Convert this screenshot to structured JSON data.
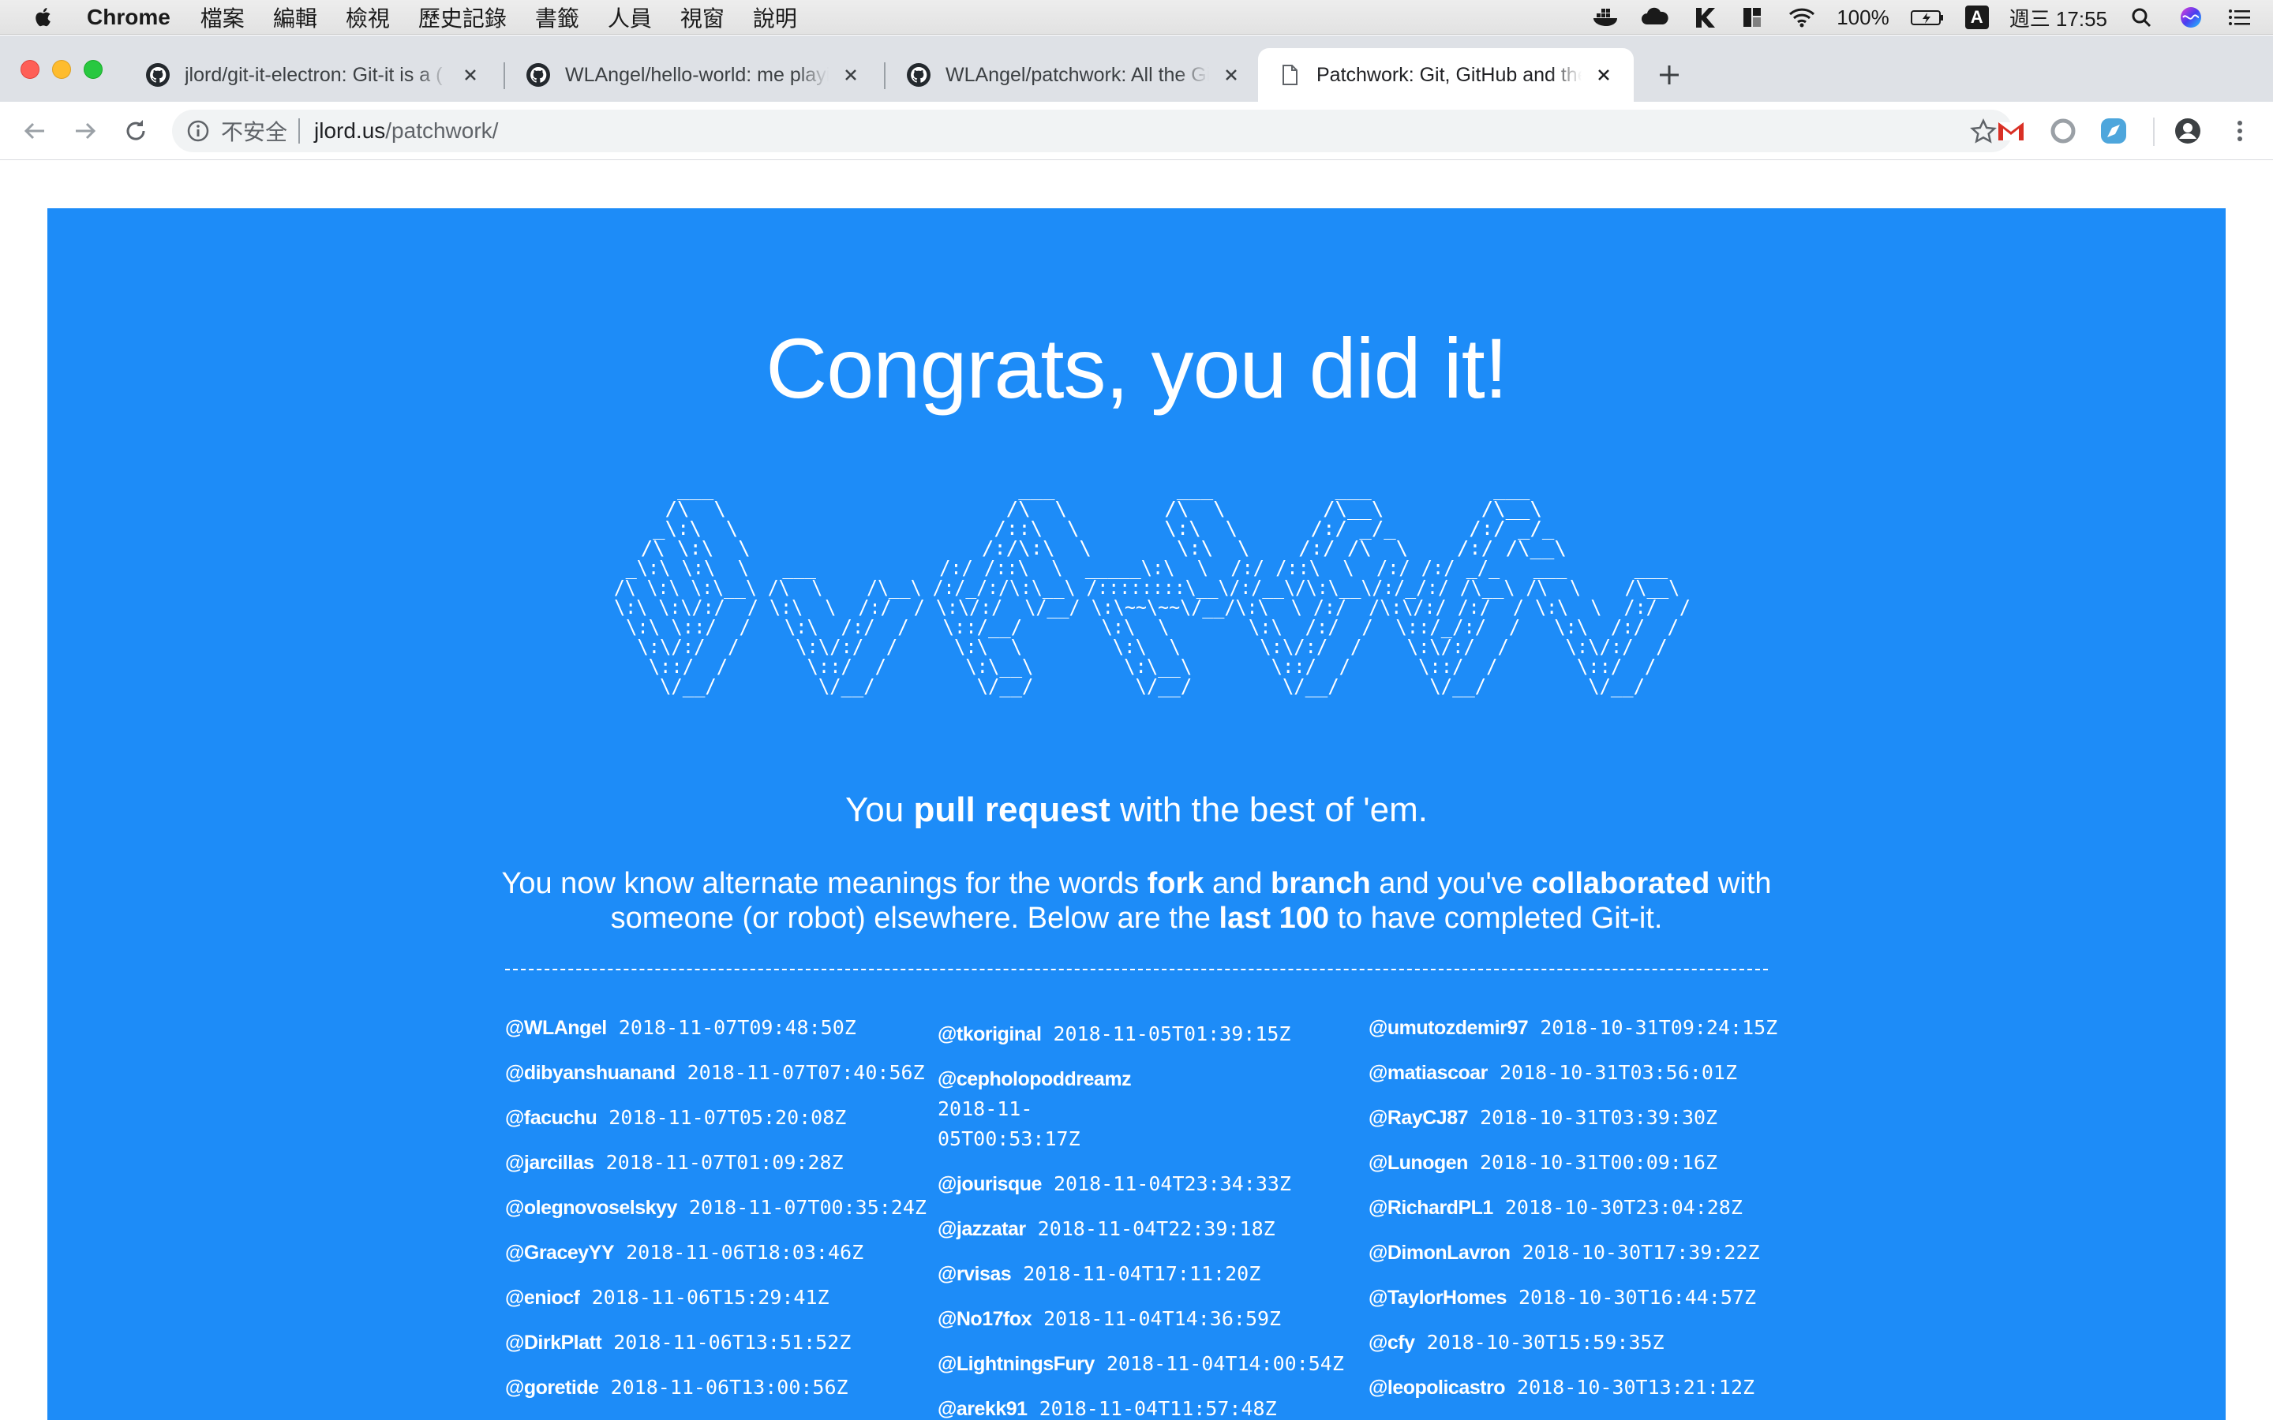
{
  "menubar": {
    "app": "Chrome",
    "items": [
      "檔案",
      "編輯",
      "檢視",
      "歷史記錄",
      "書籤",
      "人員",
      "視窗",
      "說明"
    ],
    "battery": "100%",
    "input_method": "A",
    "clock": "週三 17:55",
    "tray_icons": [
      "docker-icon",
      "cloud-icon",
      "k-icon",
      "grid-icon",
      "wifi-icon",
      "battery-icon",
      "input-icon",
      "search-icon",
      "siri-icon",
      "list-icon"
    ]
  },
  "tabs": [
    {
      "title": "jlord/git-it-electron: Git-it is a (",
      "icon": "github-icon",
      "active": false
    },
    {
      "title": "WLAngel/hello-world: me playin",
      "icon": "github-icon",
      "active": false
    },
    {
      "title": "WLAngel/patchwork: All the Git",
      "icon": "github-icon",
      "active": false
    },
    {
      "title": "Patchwork: Git, GitHub and the",
      "icon": "document-icon",
      "active": true
    }
  ],
  "omnibox": {
    "security": "不安全",
    "host": "jlord.us",
    "path": "/patchwork/"
  },
  "page": {
    "title": "Congrats, you did it!",
    "ascii_art": [
      "       ___                         ___          ___          ___          ___               ",
      "      /\\  \\                       /\\  \\        /\\  \\        /\\__\\        /\\__\\              ",
      "     _\\:\\  \\                     /::\\  \\       \\:\\  \\      /:/ _/_      /:/ _/_             ",
      "    /\\ \\:\\  \\                   /:/\\:\\  \\       \\:\\  \\    /:/ /\\  \\    /:/ /\\__\\            ",
      "   _\\:\\ \\:\\  \\   ___           /:/ /::\\  \\  _____\\:\\  \\  /:/ /::\\  \\  /:/ /:/ _/_   ___      ___    ",
      "  /\\ \\:\\ \\:\\__\\ /\\  \\    /\\__\\ /:/_/:/\\:\\__\\ /::::::::\\__\\/:/__\\/\\:\\__\\/:/_/:/ /\\__\\ /\\  \\    /\\__\\   ",
      "  \\:\\ \\:\\/:/  / \\:\\  \\  /:/  / \\:\\/:/  \\/__/ \\:\\~~\\~~\\/__/\\:\\  \\ /:/  /\\:\\/:/ /:/  / \\:\\  \\  /:/  /  ",
      "   \\:\\ \\::/  /   \\:\\  /:/  /   \\::/__/       \\:\\  \\       \\:\\  /:/  /  \\::/_/:/  /   \\:\\  /:/  /   ",
      "    \\:\\/:/  /     \\:\\/:/  /     \\:\\  \\        \\:\\  \\       \\:\\/:/  /    \\:\\/:/  /     \\:\\/:/  /    ",
      "     \\::/  /       \\::/  /       \\:\\__\\        \\:\\__\\       \\::/  /      \\::/  /       \\::/  /     ",
      "      \\/__/         \\/__/         \\/__/         \\/__/        \\/__/        \\/__/         \\/__/      "
    ],
    "tagline_pre": "You ",
    "tagline_bold": "pull request",
    "tagline_post": " with the best of 'em.",
    "intro": {
      "t1": "You now know alternate meanings for the words ",
      "b1": "fork",
      "t2": " and ",
      "b2": "branch",
      "t3": " and you've ",
      "b3": "collaborated",
      "t4": " with someone (or robot) elsewhere. Below are the ",
      "b4": "last 100",
      "t5": " to have completed Git-it."
    },
    "columns": [
      [
        {
          "user": "@WLAngel",
          "time": "2018-11-07T09:48:50Z"
        },
        {
          "user": "@dibyanshuanand",
          "time": "2018-11-07T07:40:56Z"
        },
        {
          "user": "@facuchu",
          "time": "2018-11-07T05:20:08Z"
        },
        {
          "user": "@jarcillas",
          "time": "2018-11-07T01:09:28Z"
        },
        {
          "user": "@olegnovoselskyy",
          "time": "2018-11-07T00:35:24Z"
        },
        {
          "user": "@GraceyYY",
          "time": "2018-11-06T18:03:46Z"
        },
        {
          "user": "@eniocf",
          "time": "2018-11-06T15:29:41Z"
        },
        {
          "user": "@DirkPlatt",
          "time": "2018-11-06T13:51:52Z"
        },
        {
          "user": "@goretide",
          "time": "2018-11-06T13:00:56Z"
        }
      ],
      [
        {
          "user": "@tkoriginal",
          "time": "2018-11-05T01:39:15Z"
        },
        {
          "user": "@cepholopoddreamz",
          "time": "2018-11-05T00:53:17Z"
        },
        {
          "user": "@jourisque",
          "time": "2018-11-04T23:34:33Z"
        },
        {
          "user": "@jazzatar",
          "time": "2018-11-04T22:39:18Z"
        },
        {
          "user": "@rvisas",
          "time": "2018-11-04T17:11:20Z"
        },
        {
          "user": "@No17fox",
          "time": "2018-11-04T14:36:59Z"
        },
        {
          "user": "@LightningsFury",
          "time": "2018-11-04T14:00:54Z"
        },
        {
          "user": "@arekk91",
          "time": "2018-11-04T11:57:48Z"
        }
      ],
      [
        {
          "user": "@umutozdemir97",
          "time": "2018-10-31T09:24:15Z"
        },
        {
          "user": "@matiascoar",
          "time": "2018-10-31T03:56:01Z"
        },
        {
          "user": "@RayCJ87",
          "time": "2018-10-31T03:39:30Z"
        },
        {
          "user": "@Lunogen",
          "time": "2018-10-31T00:09:16Z"
        },
        {
          "user": "@RichardPL1",
          "time": "2018-10-30T23:04:28Z"
        },
        {
          "user": "@DimonLavron",
          "time": "2018-10-30T17:39:22Z"
        },
        {
          "user": "@TaylorHomes",
          "time": "2018-10-30T16:44:57Z"
        },
        {
          "user": "@cfy",
          "time": "2018-10-30T15:59:35Z"
        },
        {
          "user": "@leopolicastro",
          "time": "2018-10-30T13:21:12Z"
        }
      ]
    ]
  },
  "colors": {
    "page_panel": "#1d8cf8",
    "tabstrip": "#dee1e6",
    "gmail_red": "#d93025"
  }
}
